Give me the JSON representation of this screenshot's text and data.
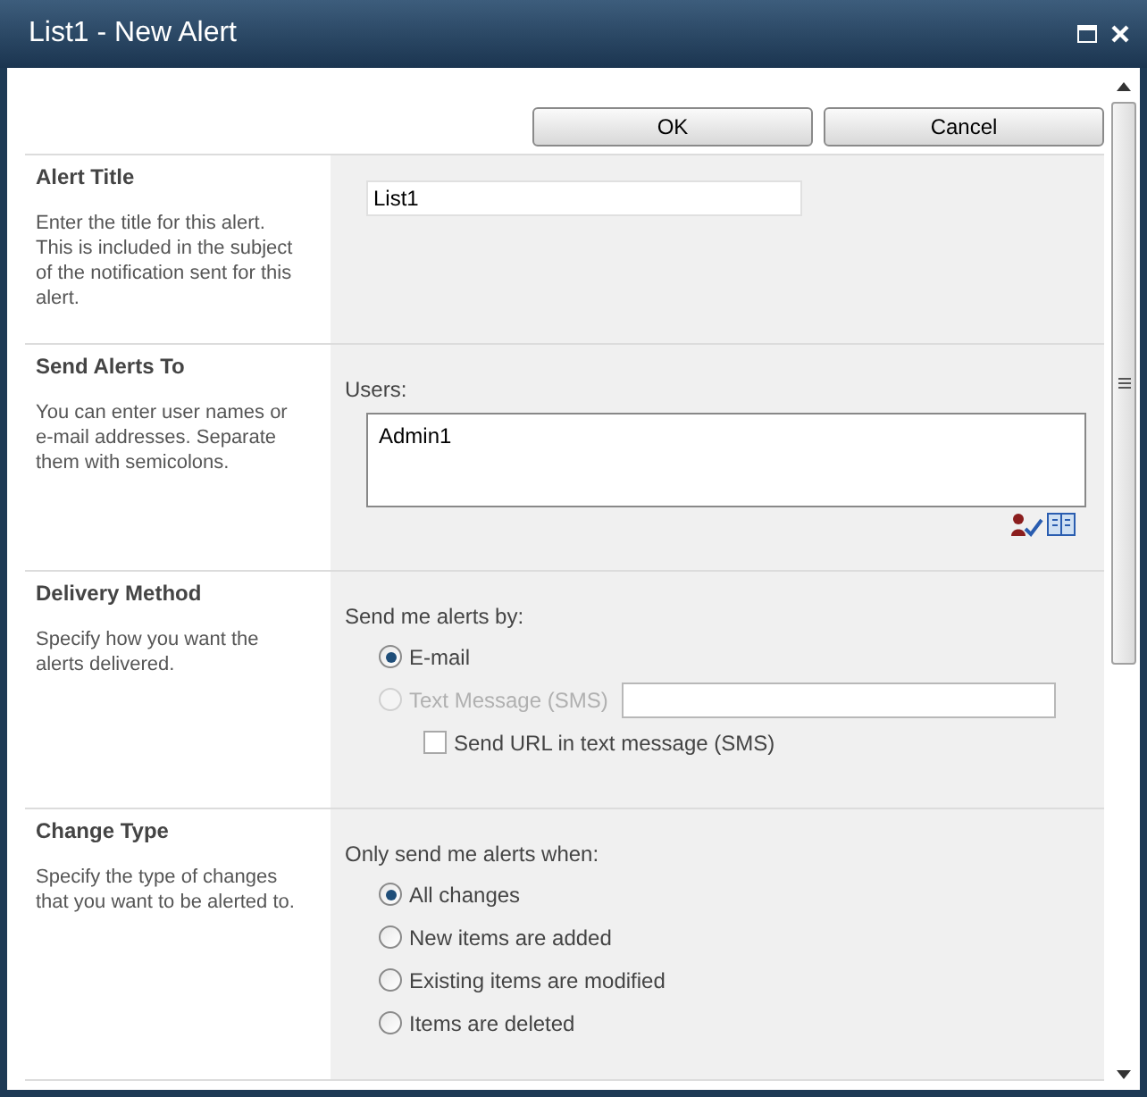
{
  "window": {
    "title": "List1 - New Alert"
  },
  "buttons": [
    "OK",
    "Cancel"
  ],
  "sections": [
    {
      "kind": "text",
      "heading": "Alert Title",
      "description": "Enter the title for this alert. This is included in the subject of the notification sent for this alert.",
      "value": "List1"
    },
    {
      "kind": "users",
      "heading": "Send Alerts To",
      "description": "You can enter user names or e-mail addresses. Separate them with semicolons.",
      "label": "Users:",
      "value": "Admin1"
    },
    {
      "kind": "choices",
      "heading": "Delivery Method",
      "description": "Specify how you want the alerts delivered.",
      "label": "Send me alerts by:",
      "options": [
        {
          "kind": "radio",
          "label": "E-mail",
          "selected": true,
          "disabled": false
        },
        {
          "kind": "radio_field",
          "label": "Text Message (SMS)",
          "selected": false,
          "disabled": true
        }
      ],
      "checkbox": {
        "label": "Send URL in text message (SMS)",
        "checked": false
      }
    },
    {
      "kind": "choices",
      "heading": "Change Type",
      "description": "Specify the type of changes that you want to be alerted to.",
      "label": "Only send me alerts when:",
      "options": [
        {
          "kind": "radio",
          "label": "All changes",
          "selected": true,
          "disabled": false
        },
        {
          "kind": "radio",
          "label": "New items are added",
          "selected": false,
          "disabled": false
        },
        {
          "kind": "radio",
          "label": "Existing items are modified",
          "selected": false,
          "disabled": false
        },
        {
          "kind": "radio",
          "label": "Items are deleted",
          "selected": false,
          "disabled": false
        }
      ]
    }
  ]
}
